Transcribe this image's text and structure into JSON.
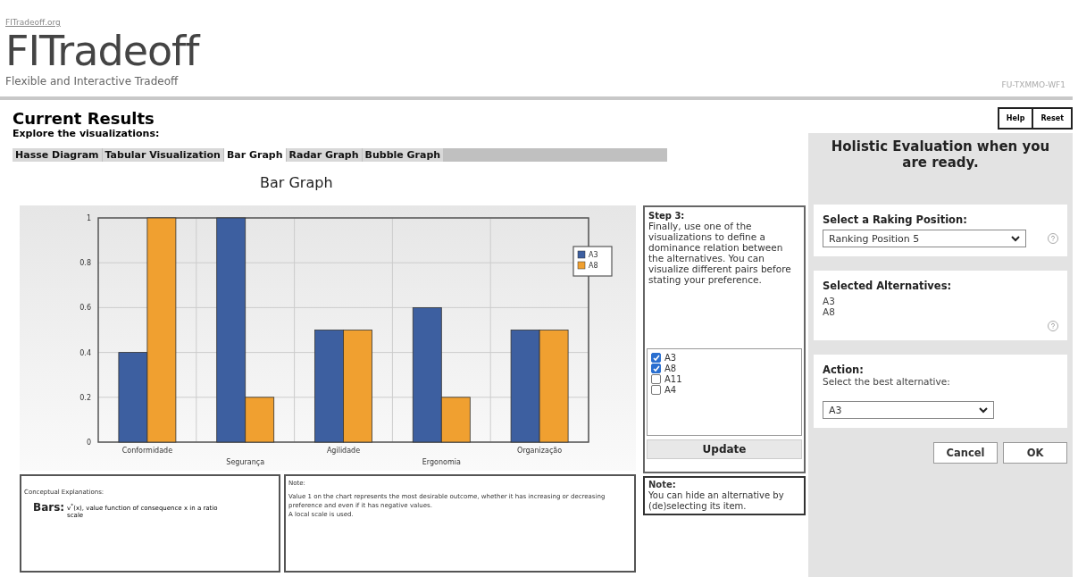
{
  "header": {
    "site_link": "FITradeoff.org",
    "logo": "FITradeoff",
    "tagline": "Flexible and Interactive Tradeoff",
    "code": "FU-TXMMO-WF1"
  },
  "title": "Current Results",
  "subtitle": "Explore the visualizations:",
  "tabs": [
    {
      "label": "Hasse Diagram",
      "selected": false
    },
    {
      "label": "Tabular Visualization",
      "selected": false
    },
    {
      "label": "Bar Graph",
      "selected": true
    },
    {
      "label": "Radar Graph",
      "selected": false
    },
    {
      "label": "Bubble Graph",
      "selected": false
    }
  ],
  "graph_title": "Bar Graph",
  "chart_data": {
    "type": "bar",
    "categories": [
      "Conformidade",
      "Segurança",
      "Agilidade",
      "Ergonomia",
      "Organização"
    ],
    "series": [
      {
        "name": "A3",
        "color": "#3d5fa0",
        "values": [
          0.4,
          1,
          0.5,
          0.6,
          0.5
        ]
      },
      {
        "name": "A8",
        "color": "#f0a030",
        "values": [
          1,
          0.2,
          0.5,
          0.2,
          0.5
        ]
      }
    ],
    "ylim": [
      0,
      1
    ],
    "yticks": [
      0,
      0.2,
      0.4,
      0.6,
      0.8,
      1
    ],
    "grid": true,
    "legend": "right"
  },
  "explanations": {
    "heading": "Conceptual Explanations:",
    "term": "Bars:",
    "definition": "v$^{*}$(x), value function of consequence x in a ratio scale"
  },
  "note": {
    "heading": "Note:",
    "lines": [
      "Value 1 on the chart represents the most desirable outcome, whether it has increasing or decreasing preference and even if it has negative values.",
      "A local scale is used."
    ]
  },
  "step": {
    "heading": "Step 3:",
    "text": "Finally, use one of the visualizations to define a dominance relation between the alternatives. You can visualize different pairs before stating your preference."
  },
  "alternatives": [
    {
      "label": "A3",
      "checked": true
    },
    {
      "label": "A8",
      "checked": true
    },
    {
      "label": "A11",
      "checked": false
    },
    {
      "label": "A4",
      "checked": false
    }
  ],
  "update_button": "Update",
  "hide_note": {
    "heading": "Note:",
    "text": "You can hide an alternative by (de)selecting its item."
  },
  "top_buttons": [
    "Help",
    "Reset"
  ],
  "holistic": {
    "heading": "Holistic Evaluation when you are ready.",
    "ranking_label": "Select a Raking Position:",
    "ranking_value": "Ranking Position 5",
    "selected_label": "Selected Alternatives:",
    "selected": [
      "A3",
      "A8"
    ],
    "action_label": "Action:",
    "action_hint": "Select the best alternative:",
    "action_value": "A3",
    "buttons": [
      "Cancel",
      "OK"
    ]
  }
}
